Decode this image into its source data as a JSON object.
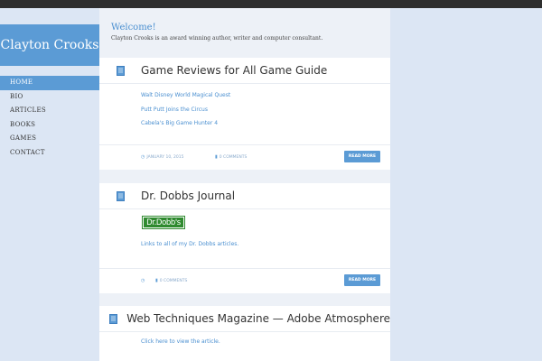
{
  "site": {
    "name": "Clayton Crooks"
  },
  "nav": {
    "items": [
      {
        "label": "HOME",
        "active": true
      },
      {
        "label": "BIO",
        "active": false
      },
      {
        "label": "ARTICLES",
        "active": false
      },
      {
        "label": "BOOKS",
        "active": false
      },
      {
        "label": "GAMES",
        "active": false
      },
      {
        "label": "CONTACT",
        "active": false
      }
    ]
  },
  "welcome": {
    "title": "Welcome!",
    "text": "Clayton Crooks is an award winning author, writer and computer consultant."
  },
  "posts": [
    {
      "title": "Game Reviews for All Game Guide",
      "links": [
        "Walt Disney World Magical Quest",
        "Putt Putt Joins the Circus",
        "Cabela's Big Game Hunter 4"
      ],
      "date": "JANUARY 10, 2015",
      "comments": "0 COMMENTS",
      "read_more": "READ MORE"
    },
    {
      "title": "Dr. Dobbs Journal",
      "logo_text": "Dr.Dobb's",
      "links": [
        "Links to all of my Dr. Dobbs articles."
      ],
      "comments": "0 COMMENTS",
      "read_more": "READ MORE"
    },
    {
      "title": "Web Techniques Magazine — Adobe Atmosphere",
      "links": [
        "Click here to view the article."
      ]
    }
  ],
  "colors": {
    "accent": "#5b9bd5",
    "link": "#4a8fd0",
    "page_bg": "#dce6f4",
    "main_bg": "#edf1f7",
    "topbar": "#2e2e2e",
    "logo_green": "#2f8a2f"
  },
  "icons": {
    "post": "document-icon",
    "date": "clock-icon",
    "comments": "speech-bubble-icon"
  }
}
